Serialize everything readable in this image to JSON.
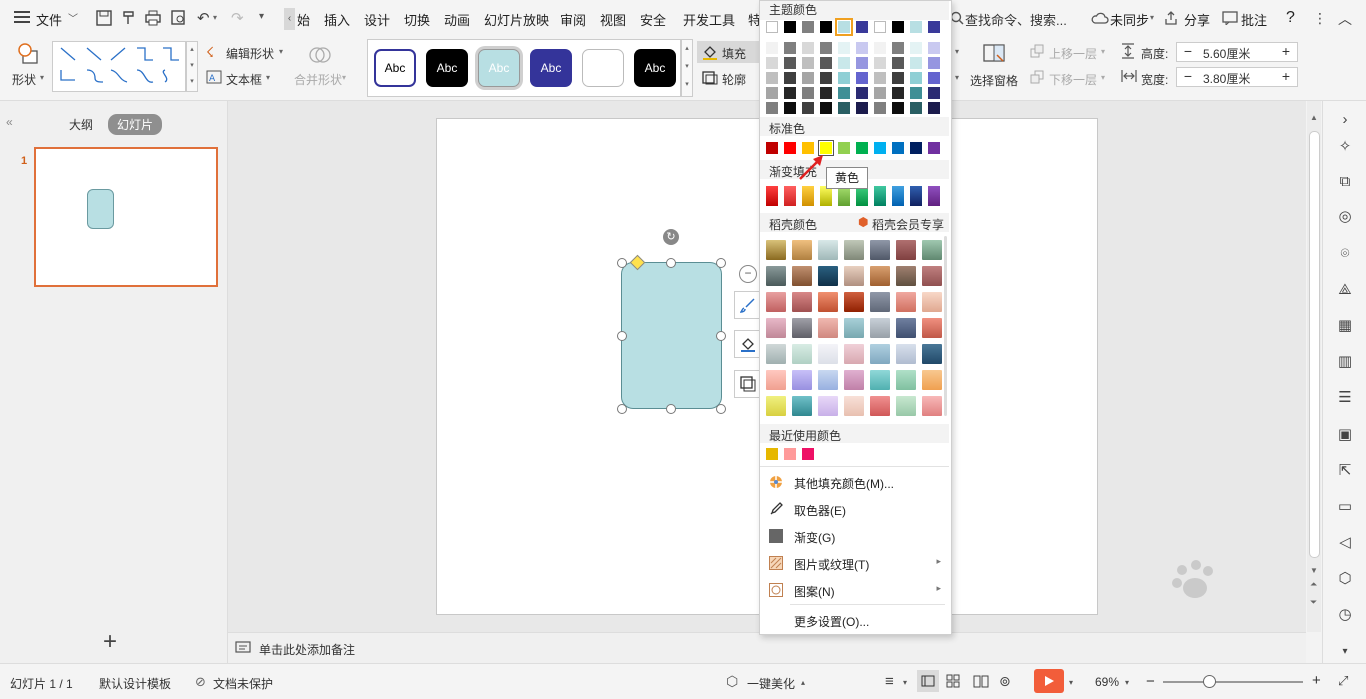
{
  "menubar": {
    "menu_label": "文件",
    "tabs": [
      "始",
      "插入",
      "设计",
      "切换",
      "动画",
      "幻灯片放映",
      "审阅",
      "视图",
      "安全",
      "开发工具",
      "特"
    ],
    "search_placeholder": "查找命令、搜索...",
    "sync": "未同步",
    "share": "分享",
    "comment": "批注",
    "help": "?"
  },
  "ribbon": {
    "shape": "形状",
    "edit_shape": "编辑形状",
    "textbox": "文本框",
    "merge_shape": "合并形状",
    "style_sample": "Abc",
    "fill": "填充",
    "outline": "轮廓",
    "selection_pane": "选择窗格",
    "bring_forward": "上移一层",
    "send_backward": "下移一层",
    "height_label": "高度:",
    "height_value": "5.60厘米",
    "width_label": "宽度:",
    "width_value": "3.80厘米"
  },
  "leftpanel": {
    "tab_outline": "大纲",
    "tab_slides": "幻灯片",
    "slide_number": "1",
    "add": "+"
  },
  "notes": {
    "placeholder": "单击此处添加备注"
  },
  "statusbar": {
    "slide_count": "幻灯片 1 / 1",
    "template": "默认设计模板",
    "protect": "文档未保护",
    "beautify": "一键美化",
    "zoom": "69%",
    "minus": "−",
    "plus": "+"
  },
  "colorpanel": {
    "theme_title": "主题颜色",
    "standard_title": "标准色",
    "gradient_title": "渐变填充",
    "docer_title": "稻壳颜色",
    "docer_member": "稻壳会员专享",
    "recent_title": "最近使用颜色",
    "tooltip": "黄色",
    "menu": [
      {
        "label": "其他填充颜色(M)...",
        "icon": "palette-icon",
        "arrow": ""
      },
      {
        "label": "取色器(E)",
        "icon": "eyedropper-icon",
        "arrow": ""
      },
      {
        "label": "渐变(G)",
        "icon": "gradient-icon",
        "arrow": ""
      },
      {
        "label": "图片或纹理(T)",
        "icon": "texture-icon",
        "arrow": "▸"
      },
      {
        "label": "图案(N)",
        "icon": "pattern-icon",
        "arrow": "▸"
      },
      {
        "label": "更多设置(O)...",
        "icon": "",
        "arrow": ""
      }
    ],
    "theme_top": [
      "#ffffff",
      "#000000",
      "#808080",
      "#000000",
      "#b8dfe3",
      "#3a3a9a",
      "#ffffff",
      "#000000",
      "#b8dfe3",
      "#3a3a9a"
    ],
    "theme_shades": [
      [
        "#f2f2f2",
        "#7f7f7f",
        "#d8d8d8",
        "#7f7f7f",
        "#e4f3f4",
        "#c9c9f0",
        "#f2f2f2",
        "#7f7f7f",
        "#e4f3f4",
        "#c9c9f0"
      ],
      [
        "#d8d8d8",
        "#595959",
        "#bfbfbf",
        "#595959",
        "#c9e8ea",
        "#9696e0",
        "#d8d8d8",
        "#595959",
        "#c9e8ea",
        "#9696e0"
      ],
      [
        "#bfbfbf",
        "#3f3f3f",
        "#a5a5a5",
        "#3f3f3f",
        "#8fcfd5",
        "#6464cf",
        "#bfbfbf",
        "#3f3f3f",
        "#8fcfd5",
        "#6464cf"
      ],
      [
        "#a5a5a5",
        "#262626",
        "#7f7f7f",
        "#262626",
        "#3f8f96",
        "#2b2b73",
        "#a5a5a5",
        "#262626",
        "#3f8f96",
        "#2b2b73"
      ],
      [
        "#7f7f7f",
        "#0d0d0d",
        "#3f3f3f",
        "#0d0d0d",
        "#2a5f64",
        "#1c1c4d",
        "#7f7f7f",
        "#0d0d0d",
        "#2a5f64",
        "#1c1c4d"
      ]
    ],
    "standard": [
      "#c00000",
      "#ff0000",
      "#ffc000",
      "#ffff00",
      "#92d050",
      "#00b050",
      "#00b0f0",
      "#0070c0",
      "#002060",
      "#7030a0"
    ],
    "gradients": [
      [
        "#ff4040",
        "#c00000"
      ],
      [
        "#ff6060",
        "#d02020"
      ],
      [
        "#ffd040",
        "#d09000"
      ],
      [
        "#ffff60",
        "#b0b000"
      ],
      [
        "#a8e070",
        "#60a030"
      ],
      [
        "#40d080",
        "#009040"
      ],
      [
        "#40c8a0",
        "#008060"
      ],
      [
        "#40a0e0",
        "#0060b0"
      ],
      [
        "#3060b0",
        "#102060"
      ],
      [
        "#9050c0",
        "#602080"
      ]
    ],
    "docer": [
      [
        "#d9c27a",
        "#8a6a20"
      ],
      [
        "#f0c080",
        "#b08040"
      ],
      [
        "#d8e8e8",
        "#a0b8b8"
      ],
      [
        "#c0c8b8",
        "#808878"
      ],
      [
        "#9098a8",
        "#505868"
      ],
      [
        "#b07070",
        "#804040"
      ],
      [
        "#a0c8b0",
        "#608870"
      ],
      [
        "#8a9a9a",
        "#4a5a5a"
      ],
      [
        "#c09070",
        "#805030"
      ],
      [
        "#2a6080",
        "#103048"
      ],
      [
        "#e8d0c0",
        "#b09080"
      ],
      [
        "#d8a070",
        "#a06030"
      ],
      [
        "#a08070",
        "#605040"
      ],
      [
        "#c08080",
        "#905050"
      ],
      [
        "#e8a0a0",
        "#c06060"
      ],
      [
        "#d88888",
        "#a05050"
      ],
      [
        "#f09070",
        "#c05030"
      ],
      [
        "#d06040",
        "#902000"
      ],
      [
        "#9098a8",
        "#606878"
      ],
      [
        "#f0a8a0",
        "#d07060"
      ],
      [
        "#f8d8c8",
        "#e0a890"
      ],
      [
        "#e8b8c8",
        "#c08898"
      ],
      [
        "#a0a0a8",
        "#606068"
      ],
      [
        "#f0b8b0",
        "#d08880"
      ],
      [
        "#a8d0d8",
        "#78a8b0"
      ],
      [
        "#c8d0d8",
        "#98a0a8"
      ],
      [
        "#7080a0",
        "#405070"
      ],
      [
        "#f09080",
        "#c05848"
      ],
      [
        "#d0d8d8",
        "#a0b0b0"
      ],
      [
        "#d8ece4",
        "#b0d0c4"
      ],
      [
        "#f4f4f8",
        "#dce0e8"
      ],
      [
        "#f0d0d8",
        "#d8a8b0"
      ],
      [
        "#b0d0e0",
        "#80a8c0"
      ],
      [
        "#d8e0ec",
        "#b0bcd0"
      ],
      [
        "#4a7898",
        "#204868"
      ],
      [
        "#ffc8c0",
        "#f0a090"
      ],
      [
        "#c8c0f8",
        "#9890e0"
      ],
      [
        "#c8d8f0",
        "#98b0e0"
      ],
      [
        "#e0b0d0",
        "#c080a8"
      ],
      [
        "#90d8d8",
        "#50b0b0"
      ],
      [
        "#b0e0c8",
        "#80c0a0"
      ],
      [
        "#f8c890",
        "#f0a050"
      ],
      [
        "#f0f080",
        "#d8d040"
      ],
      [
        "#70c0c8",
        "#308890"
      ],
      [
        "#e8d8f8",
        "#c8b0e8"
      ],
      [
        "#f8e0d8",
        "#e8c0b0"
      ],
      [
        "#f09090",
        "#d05858"
      ],
      [
        "#c8e8d0",
        "#98c8a8"
      ],
      [
        "#f8b8b8",
        "#e08080"
      ]
    ],
    "recent": [
      "#e6b800",
      "#ff9a9a",
      "#ee1166"
    ]
  }
}
